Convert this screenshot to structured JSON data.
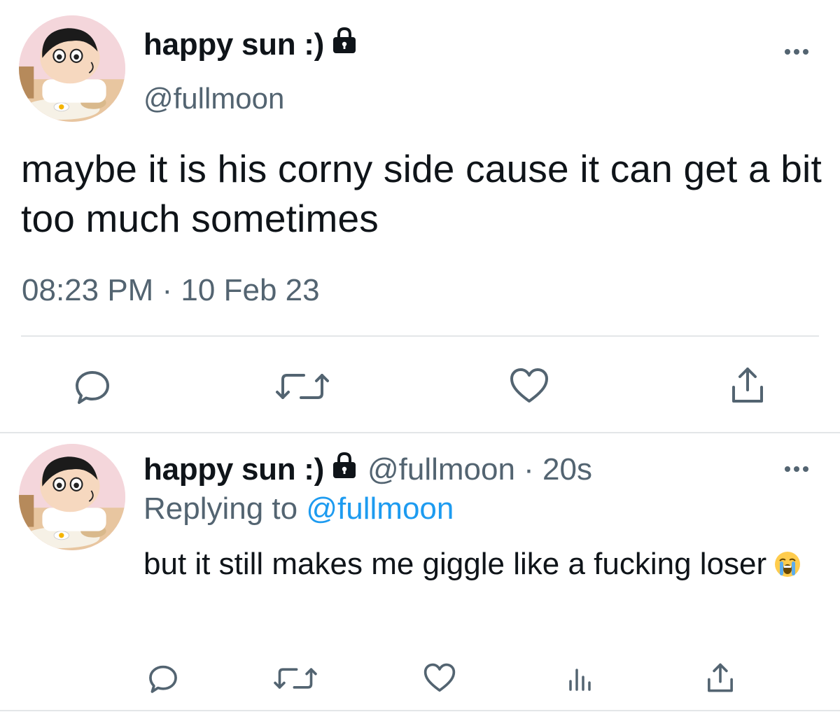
{
  "main_tweet": {
    "display_name": "happy sun :)",
    "handle": "@fullmoon",
    "text": "maybe it is his corny side cause it can get a bit too much sometimes",
    "timestamp": "08:23 PM · 10 Feb 23",
    "protected_icon": "lock-icon",
    "more_icon": "more-dots-icon",
    "actions": [
      "reply-icon",
      "retweet-icon",
      "like-icon",
      "share-icon"
    ]
  },
  "reply_tweet": {
    "display_name": "happy sun :)",
    "handle_time": "@fullmoon · 20s",
    "replying_prefix": "Replying to",
    "replying_mention": "@fullmoon",
    "text": "but it still makes me giggle like a fucking loser",
    "emoji": "loudly-crying-face-emoji",
    "protected_icon": "lock-icon",
    "more_icon": "more-dots-icon",
    "actions": [
      "reply-icon",
      "retweet-icon",
      "like-icon",
      "analytics-icon",
      "share-icon"
    ]
  },
  "colors": {
    "text": "#0f1419",
    "secondary": "#536471",
    "link": "#1d9bf0",
    "divider": "#e3e6e8"
  }
}
